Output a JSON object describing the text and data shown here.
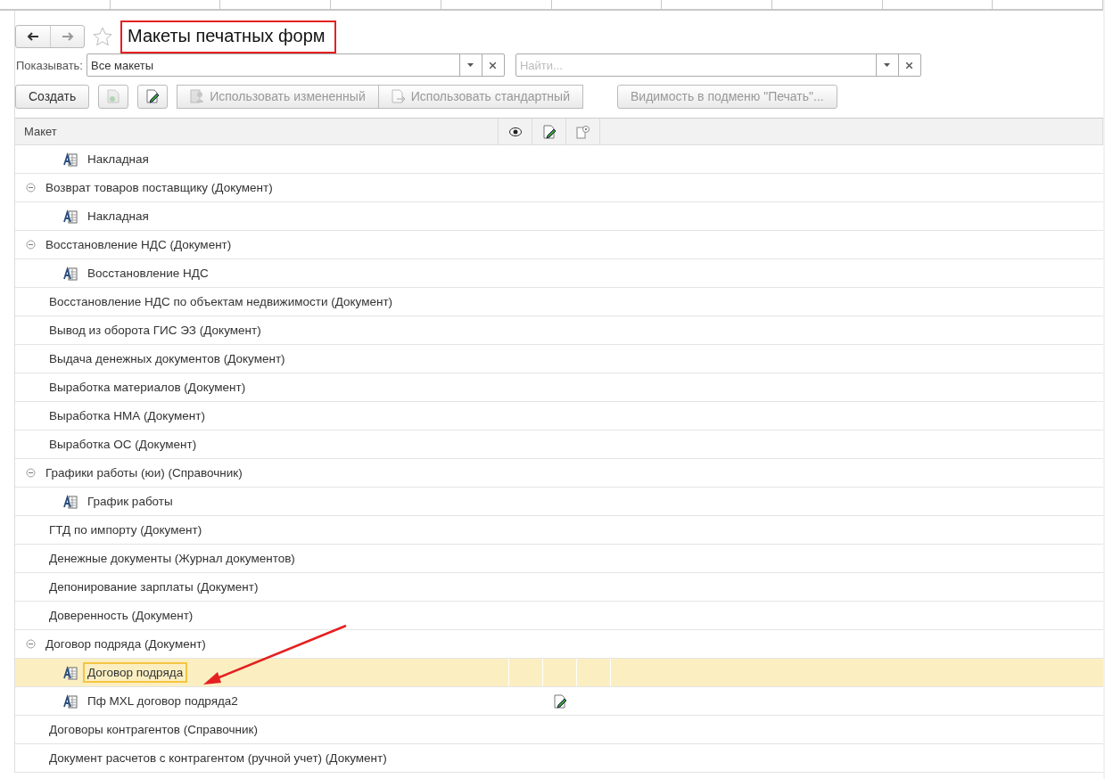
{
  "window": {
    "title": "Макеты печатных форм",
    "title_highlighted": true
  },
  "filter": {
    "label": "Показывать:",
    "value": "Все макеты"
  },
  "search": {
    "placeholder": "Найти..."
  },
  "toolbar": [
    {
      "kind": "text",
      "label": "Создать",
      "disabled": false
    },
    {
      "kind": "add-icon",
      "disabled": true
    },
    {
      "kind": "edit-icon",
      "disabled": false
    },
    {
      "kind": "icon-text",
      "label": "Использовать измененный",
      "disabled": true
    },
    {
      "kind": "icon-text2",
      "label": "Использовать стандартный",
      "disabled": true
    },
    {
      "kind": "text",
      "label": "Видимость в подменю \"Печать\"...",
      "disabled": true
    }
  ],
  "table": {
    "columns": [
      "Макет"
    ],
    "rows": [
      {
        "kind": "template",
        "name": "Накладная",
        "selected": false,
        "edited": false
      },
      {
        "kind": "group",
        "name": "Возврат товаров поставщику (Документ)",
        "expanded": true,
        "selected": false,
        "edited": false,
        "children": [
          {
            "kind": "template",
            "name": "Накладная",
            "selected": false,
            "edited": false
          }
        ]
      },
      {
        "kind": "group",
        "name": "Восстановление НДС (Документ)",
        "expanded": true,
        "selected": false,
        "edited": false,
        "children": [
          {
            "kind": "template",
            "name": "Восстановление НДС",
            "selected": false,
            "edited": false
          }
        ]
      },
      {
        "kind": "object",
        "name": "Восстановление НДС по объектам недвижимости (Документ)",
        "selected": false,
        "edited": false
      },
      {
        "kind": "object",
        "name": "Вывод из оборота ГИС ЭЗ (Документ)",
        "selected": false,
        "edited": false
      },
      {
        "kind": "object",
        "name": "Выдача денежных документов (Документ)",
        "selected": false,
        "edited": false
      },
      {
        "kind": "object",
        "name": "Выработка материалов (Документ)",
        "selected": false,
        "edited": false
      },
      {
        "kind": "object",
        "name": "Выработка НМА (Документ)",
        "selected": false,
        "edited": false
      },
      {
        "kind": "object",
        "name": "Выработка ОС (Документ)",
        "selected": false,
        "edited": false
      },
      {
        "kind": "group",
        "name": "Графики работы (юи) (Справочник)",
        "expanded": true,
        "selected": false,
        "edited": false,
        "children": [
          {
            "kind": "template",
            "name": "График работы",
            "selected": false,
            "edited": false
          }
        ]
      },
      {
        "kind": "object",
        "name": "ГТД по импорту (Документ)",
        "selected": false,
        "edited": false
      },
      {
        "kind": "object",
        "name": "Денежные документы (Журнал документов)",
        "selected": false,
        "edited": false
      },
      {
        "kind": "object",
        "name": "Депонирование зарплаты (Документ)",
        "selected": false,
        "edited": false
      },
      {
        "kind": "object",
        "name": "Доверенность (Документ)",
        "selected": false,
        "edited": false
      },
      {
        "kind": "group",
        "name": "Договор подряда (Документ)",
        "expanded": true,
        "selected": false,
        "edited": false,
        "children": [
          {
            "kind": "template",
            "name": "Договор подряда",
            "selected": true,
            "edited": false
          },
          {
            "kind": "template",
            "name": "Пф MXL договор подряда2",
            "selected": false,
            "edited": true
          }
        ]
      },
      {
        "kind": "object",
        "name": "Договоры контрагентов (Справочник)",
        "selected": false,
        "edited": false
      },
      {
        "kind": "object",
        "name": "Документ расчетов с контрагентом (ручной учет) (Документ)",
        "selected": false,
        "edited": false
      }
    ]
  }
}
